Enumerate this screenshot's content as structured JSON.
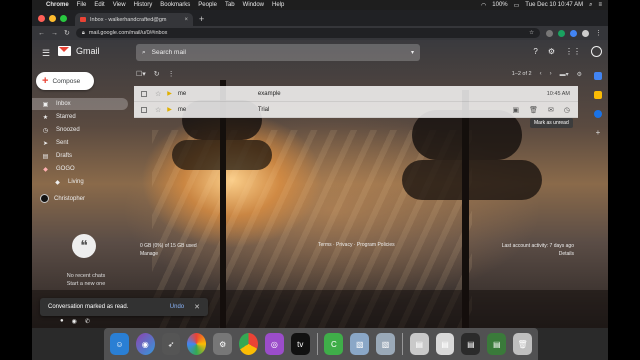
{
  "menubar": {
    "app_name": "Chrome",
    "items": [
      "File",
      "Edit",
      "View",
      "History",
      "Bookmarks",
      "People",
      "Tab",
      "Window",
      "Help"
    ],
    "battery": "100%",
    "clock": "Tue Dec 10  10:47 AM"
  },
  "browser": {
    "tab_title": "Inbox - walkerhandcrafted@gm",
    "url": "mail.google.com/mail/u/0/#inbox"
  },
  "gmail": {
    "logo_text": "Gmail",
    "search_placeholder": "Search mail",
    "compose_label": "Compose",
    "nav": [
      {
        "label": "Inbox",
        "icon": "inbox-icon"
      },
      {
        "label": "Starred",
        "icon": "star-icon"
      },
      {
        "label": "Snoozed",
        "icon": "clock-icon"
      },
      {
        "label": "Sent",
        "icon": "send-icon"
      },
      {
        "label": "Drafts",
        "icon": "draft-icon"
      },
      {
        "label": "GOGO",
        "icon": "label-icon"
      },
      {
        "label": "Living",
        "icon": "label-icon"
      }
    ],
    "hangouts_user": "Christopher",
    "chat_empty_line1": "No recent chats",
    "chat_empty_line2": "Start a new one",
    "pagination": "1–2 of 2",
    "messages": [
      {
        "from": "me",
        "subject": "example",
        "date": "10:45 AM"
      },
      {
        "from": "me",
        "subject": "Trial",
        "date": ""
      }
    ],
    "tooltip": "Mark as unread",
    "storage_line1": "0 GB (0%) of 15 GB used",
    "storage_line2": "Manage",
    "policies": "Terms · Privacy · Program Policies",
    "activity_line1": "Last account activity: 7 days ago",
    "activity_line2": "Details",
    "snackbar_text": "Conversation marked as read.",
    "snackbar_undo": "Undo"
  }
}
